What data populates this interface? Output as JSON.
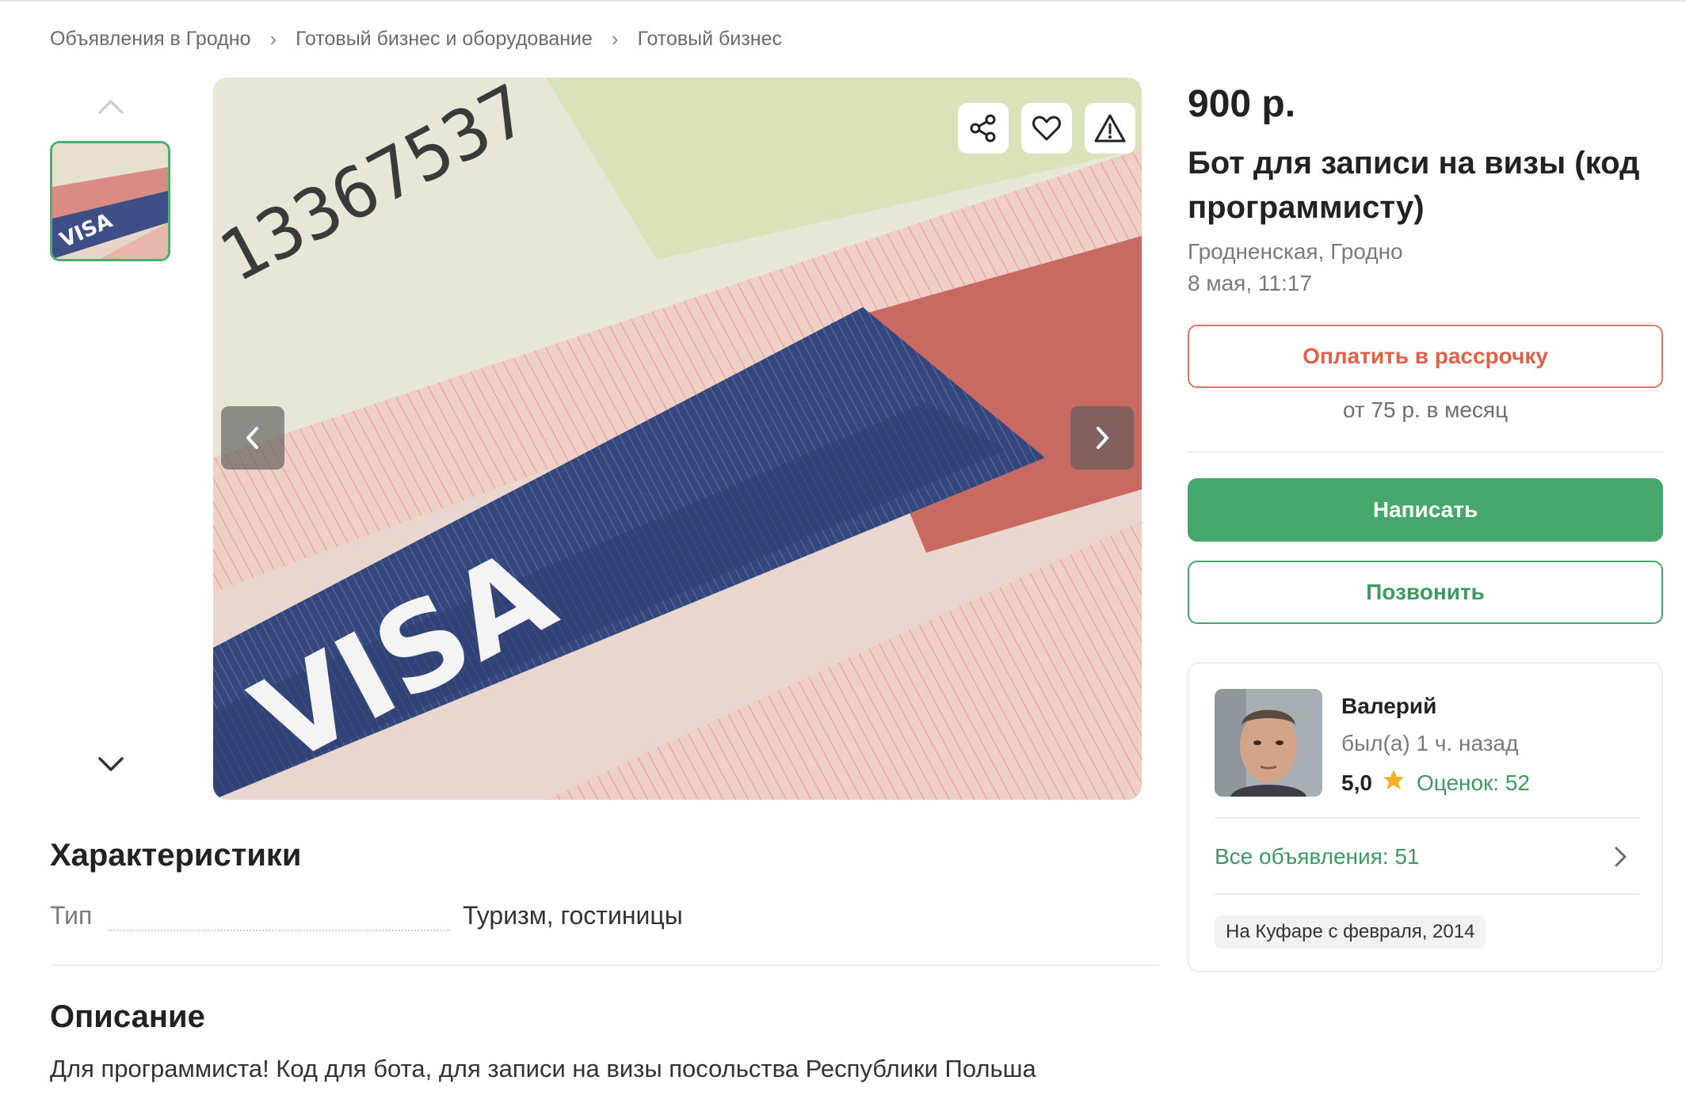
{
  "breadcrumb": [
    "Объявления в Гродно",
    "Готовый бизнес и оборудование",
    "Готовый бизнес"
  ],
  "gallery": {
    "thumb_icon": "chevron-up-icon",
    "photo_text": "VISA",
    "photo_number": "13367537"
  },
  "listing": {
    "price": "900 р.",
    "title": "Бот для записи на визы (код программисту)",
    "region": "Гродненская, Гродно",
    "date": "8 мая, 11:17"
  },
  "actions": {
    "installment_label": "Оплатить в рассрочку",
    "installment_note": "от 75 р. в месяц",
    "write_label": "Написать",
    "call_label": "Позвонить"
  },
  "seller": {
    "name": "Валерий",
    "last_seen": "был(а) 1 ч. назад",
    "score": "5,0",
    "reviews": "Оценок: 52",
    "all_ads": "Все объявления: 51",
    "since": "На Куфаре с февраля, 2014"
  },
  "characteristics": {
    "heading": "Характеристики",
    "rows": [
      {
        "label": "Тип",
        "value": "Туризм, гостиницы"
      }
    ]
  },
  "description": {
    "heading": "Описание",
    "text": "Для программиста! Код для бота, для записи на визы посольства Республики Польша"
  },
  "colors": {
    "accent_green": "#46a76a",
    "installment_red": "#e0604a"
  }
}
